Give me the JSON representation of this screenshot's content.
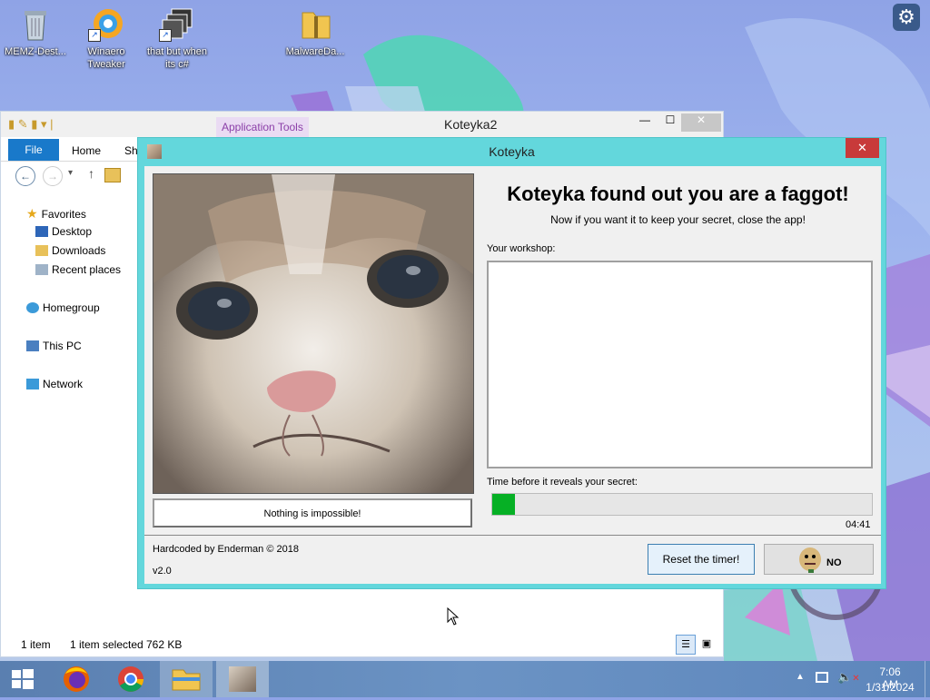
{
  "desktop": {
    "icons": [
      {
        "label": "MEMZ-Dest..."
      },
      {
        "label": "Winaero Tweaker"
      },
      {
        "label": "that but when its c#"
      },
      {
        "label": "MalwareDa..."
      }
    ]
  },
  "explorer": {
    "title": "Koteyka2",
    "app_tools": "Application Tools",
    "tabs": [
      "File",
      "Home",
      "Sha"
    ],
    "nav": {
      "favorites": "Favorites",
      "desktop": "Desktop",
      "downloads": "Downloads",
      "recent": "Recent places",
      "homegroup": "Homegroup",
      "thispc": "This PC",
      "network": "Network"
    },
    "status": {
      "count": "1 item",
      "selected": "1 item selected",
      "size": "762 KB"
    }
  },
  "dialog": {
    "title": "Koteyka",
    "headline": "Koteyka found out you are a faggot!",
    "subline": "Now if you want it to keep your secret, close the app!",
    "workshop_label": "Your workshop:",
    "workshop_value": "",
    "timer_label": "Time before it reveals your secret:",
    "progress_fraction": 0.06,
    "timer_value": "04:41",
    "image_caption_button": "Nothing is impossible!",
    "credit": "Hardcoded by Enderman © 2018",
    "version": "v2.0",
    "reset_button": "Reset the timer!",
    "no_button_text": "NO"
  },
  "taskbar": {
    "time": "7:06 AM",
    "date": "1/31/2024"
  }
}
